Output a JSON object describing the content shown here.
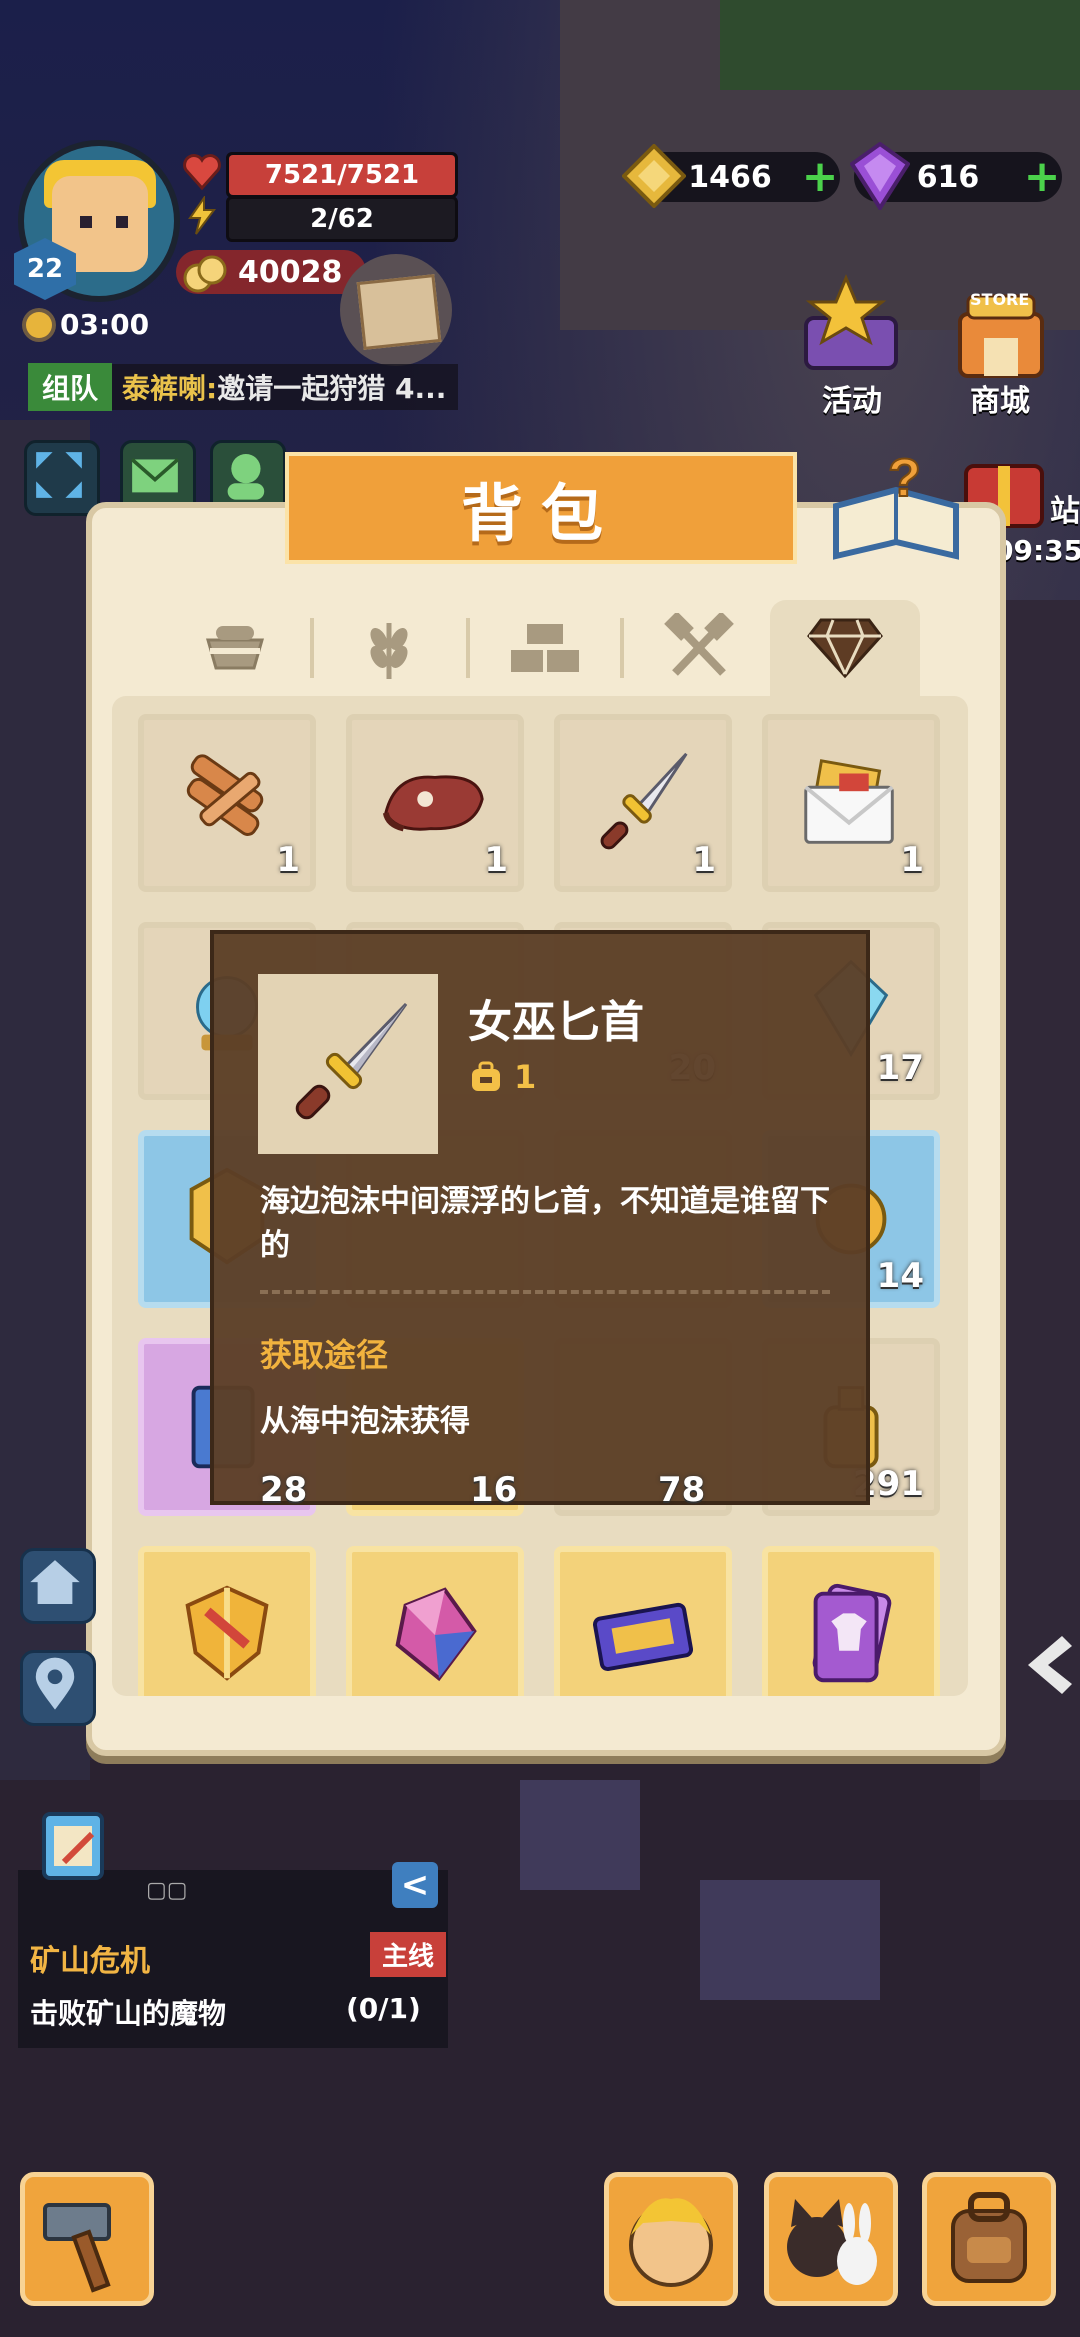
{
  "hud": {
    "level": "22",
    "hp": "7521/7521",
    "hp_fraction": 1.0,
    "energy": "2/62",
    "gold": "40028",
    "time": "03:00",
    "coin_currency": "1466",
    "gem_currency": "616",
    "team_tag": "组队",
    "team_player": "泰裤喇:",
    "team_message": "邀请一起狩猎 4..."
  },
  "side_buttons": {
    "events_label": "活动",
    "shop_label": "商城",
    "store_sign": "STORE",
    "timer_partial": "09:35",
    "partial_label": "站"
  },
  "backpack": {
    "title": "背包",
    "tabs": [
      "bowl-icon",
      "wheat-icon",
      "bricks-icon",
      "tools-icon",
      "gem-icon"
    ],
    "active_tab": 4,
    "rows": [
      [
        {
          "icon": "wood-logs-icon",
          "count": "1",
          "bg": "plain"
        },
        {
          "icon": "steak-icon",
          "count": "1",
          "bg": "plain"
        },
        {
          "icon": "dagger-icon",
          "count": "1",
          "bg": "plain"
        },
        {
          "icon": "letter-icon",
          "count": "1",
          "bg": "plain"
        }
      ],
      [
        {
          "icon": "orb-icon",
          "count": "",
          "bg": "plain"
        },
        {
          "icon": "hidden-icon",
          "count": "",
          "bg": "plain"
        },
        {
          "icon": "hidden-icon",
          "count": "20",
          "bg": "plain"
        },
        {
          "icon": "crystal-icon",
          "count": "17",
          "bg": "plain"
        }
      ],
      [
        {
          "icon": "badge-icon",
          "count": "",
          "bg": "blue"
        },
        {
          "icon": "hidden-icon",
          "count": "",
          "bg": "plain"
        },
        {
          "icon": "hidden-icon",
          "count": "",
          "bg": "plain"
        },
        {
          "icon": "coin-icon",
          "count": "14",
          "bg": "blue"
        }
      ],
      [
        {
          "icon": "book-icon",
          "count": "",
          "bg": "purple"
        },
        {
          "icon": "hidden-icon",
          "count": "",
          "bg": "gold"
        },
        {
          "icon": "hidden-icon",
          "count": "",
          "bg": "plain"
        },
        {
          "icon": "potion-icon",
          "count": "291",
          "bg": "plain"
        }
      ],
      [
        {
          "icon": "shield-icon",
          "count": "",
          "bg": "gold"
        },
        {
          "icon": "gem-stone-icon",
          "count": "",
          "bg": "gold"
        },
        {
          "icon": "ticket-icon",
          "count": "",
          "bg": "gold"
        },
        {
          "icon": "card-icon",
          "count": "",
          "bg": "gold"
        }
      ]
    ],
    "partial_counts": {
      "r2c2": "28",
      "r2c3": "16",
      "r2c4": "78"
    },
    "tooltip": {
      "name": "女巫匕首",
      "owned": "1",
      "description": "海边泡沫中间漂浮的匕首，不知道是谁留下的",
      "source_title": "获取途径",
      "source": "从海中泡沫获得"
    }
  },
  "quest": {
    "title": "矿山危机",
    "tag": "主线",
    "description": "击败矿山的魔物",
    "progress": "(0/1)",
    "collapse": "<",
    "dots": "▢▢"
  },
  "colors": {
    "accent_orange": "#f0a03a",
    "panel_bg": "#f4ead2",
    "tooltip_bg": "#5c3e26",
    "hp_red": "#c7403a",
    "plus_green": "#4bd14b"
  }
}
